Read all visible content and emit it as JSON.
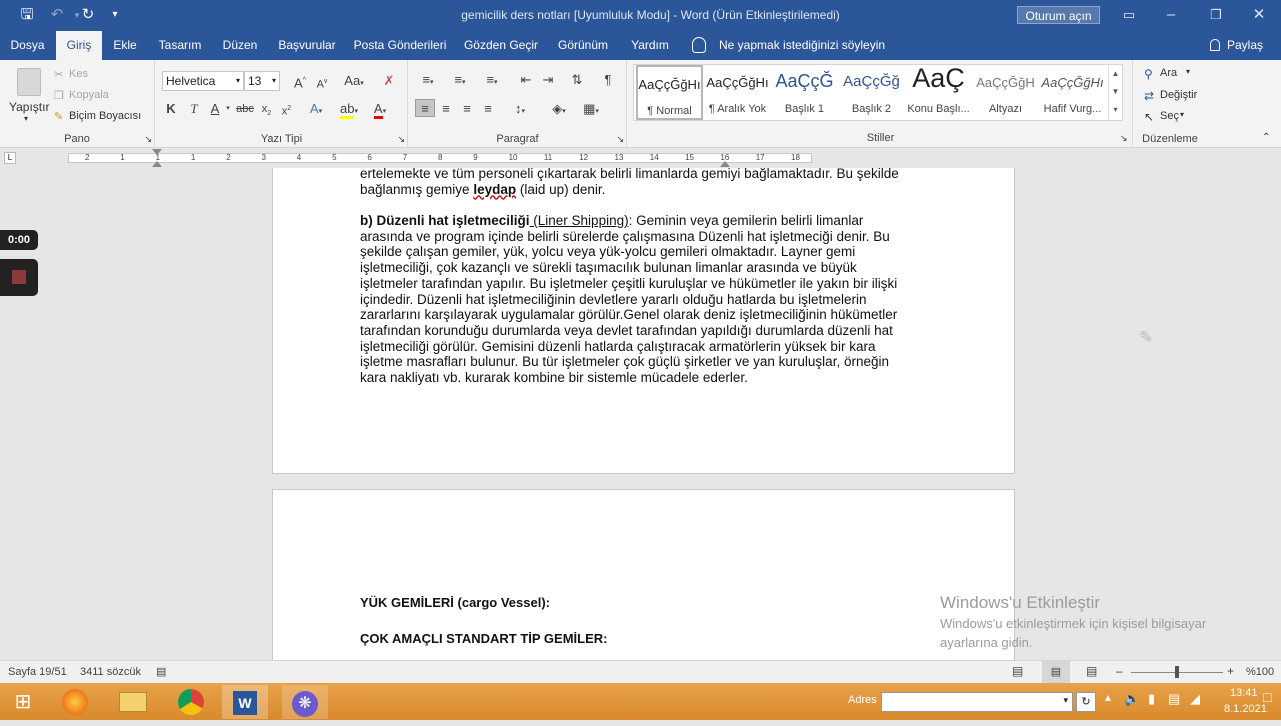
{
  "window": {
    "title": "gemicilik ders notları [Uyumluluk Modu]  -  Word (Ürün Etkinleştirilemedi)",
    "signin_label": "Oturum açın"
  },
  "tabs": [
    "Dosya",
    "Giriş",
    "Ekle",
    "Tasarım",
    "Düzen",
    "Başvurular",
    "Posta Gönderileri",
    "Gözden Geçir",
    "Görünüm",
    "Yardım"
  ],
  "tell_me": "Ne yapmak istediğinizi söyleyin",
  "share": "Paylaş",
  "ribbon": {
    "clipboard": {
      "paste": "Yapıştır",
      "cut": "Kes",
      "copy": "Kopyala",
      "format_painter": "Biçim Boyacısı",
      "label": "Pano"
    },
    "font": {
      "name": "Helvetica",
      "size": "13",
      "label": "Yazı Tipi"
    },
    "paragraph": {
      "label": "Paragraf"
    },
    "styles": {
      "label": "Stiller",
      "items": [
        {
          "preview": "AaÇçĞğHı",
          "name": "¶ Normal"
        },
        {
          "preview": "AaÇçĞğHı",
          "name": "¶ Aralık Yok"
        },
        {
          "preview": "AaÇçĞ",
          "name": "Başlık 1"
        },
        {
          "preview": "AaÇçĞğ",
          "name": "Başlık 2"
        },
        {
          "preview": "AaÇ",
          "name": "Konu Başlı..."
        },
        {
          "preview": "AaÇçĞğH",
          "name": "Altyazı"
        },
        {
          "preview": "AaÇçĞğHı",
          "name": "Hafif Vurg..."
        }
      ]
    },
    "editing": {
      "find": "Ara",
      "replace": "Değiştir",
      "select": "Seç",
      "label": "Düzenleme"
    }
  },
  "ruler_numbers": [
    "2",
    "1",
    "1",
    "1",
    "2",
    "3",
    "4",
    "5",
    "6",
    "7",
    "8",
    "9",
    "10",
    "11",
    "12",
    "13",
    "14",
    "15",
    "16",
    "17",
    "18"
  ],
  "document": {
    "top_lines": [
      "ertelemekte ve tüm personeli çıkartarak belirli limanlarda gemiyi bağlamaktadır. Bu şekilde",
      "bağlanmış gemiye "
    ],
    "leydap": "leydap",
    "leydap_rest": " (laid up) denir.",
    "b_heading": "b) Düzenli hat işletmeciliği",
    "b_paren": " (Liner Shipping)",
    "b_lines": [
      ": Geminin veya gemilerin belirli limanlar",
      "arasında ve program içinde belirli sürelerde çalışmasına Düzenli hat işletmeciği denir. Bu",
      "şekilde çalışan gemiler, yük, yolcu veya yük-yolcu gemileri olmaktadır. Layner gemi",
      "işletmeciliği, çok kazançlı ve sürekli taşımacılık bulunan limanlar arasında ve büyük",
      "işletmeler tarafından yapılır. Bu işletmeler çeşitli kuruluşlar ve hükümetler ile yakın bir ilişki",
      "içindedir. Düzenli hat işletmeciliğinin devletlere yararlı olduğu hatlarda bu işletmelerin",
      "zararlarını karşılayarak uygulamalar görülür.Genel olarak deniz işletmeciliğinin hükümetler",
      "tarafından korunduğu durumlarda veya devlet tarafından yapıldığı durumlarda düzenli hat",
      "işletmeciliği görülür. Gemisini düzenli hatlarda çalıştıracak armatörlerin yüksek bir kara",
      "işletme masrafları bulunur. Bu tür işletmeler çok güçlü şirketler ve yan kuruluşlar, örneğin",
      "kara nakliyatı vb. kurarak kombine bir sistemle mücadele ederler."
    ],
    "heading1": "YÜK GEMİLERİ (cargo Vessel):",
    "heading2": "ÇOK AMAÇLI STANDART TİP GEMİLER:"
  },
  "status": {
    "page": "Sayfa 19/51",
    "words": "3411 sözcük",
    "zoom": "%100"
  },
  "recorder": {
    "time": "0:00"
  },
  "activation": {
    "title": "Windows'u Etkinleştir",
    "line1": "Windows'u etkinleştirmek için kişisel bilgisayar",
    "line2": "ayarlarına gidin."
  },
  "taskbar": {
    "address_label": "Adres",
    "time": "13:41",
    "date": "8.1.2021"
  },
  "colors": {
    "word_blue": "#2b579a",
    "taskbar": "#e09a3e"
  }
}
